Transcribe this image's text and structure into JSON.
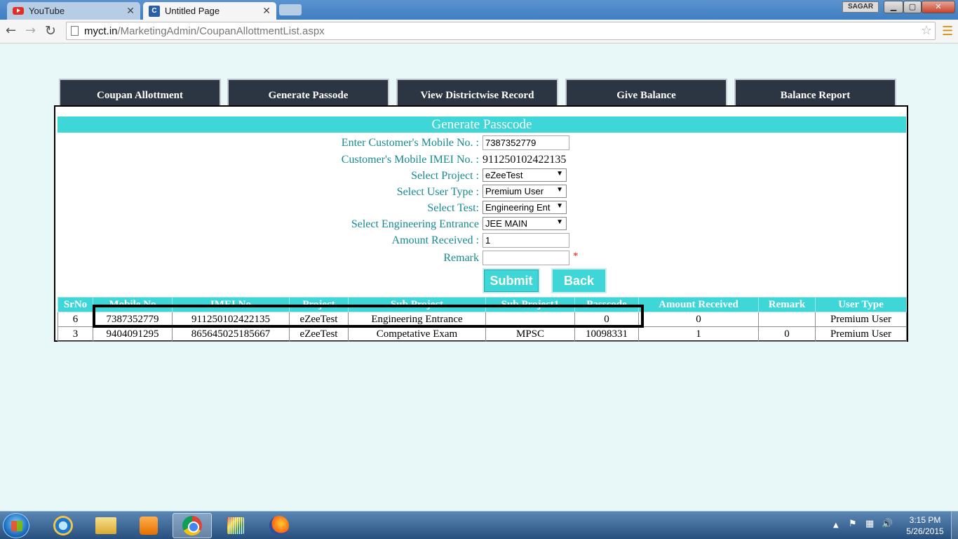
{
  "browser": {
    "tabs": [
      {
        "title": "YouTube",
        "active": false
      },
      {
        "title": "Untitled Page",
        "active": true
      }
    ],
    "user_badge": "SAGAR",
    "url_host": "myct.in",
    "url_path": "/MarketingAdmin/CoupanAllottmentList.aspx"
  },
  "nav_tabs": [
    {
      "label": "Coupan Allottment"
    },
    {
      "label": "Generate Passode"
    },
    {
      "label": "View Districtwise Record"
    },
    {
      "label": "Give Balance"
    },
    {
      "label": "Balance Report"
    }
  ],
  "form": {
    "header": "Generate Passcode",
    "mobile_label": "Enter Customer's Mobile No. :",
    "mobile_value": "7387352779",
    "imei_label": "Customer's Mobile IMEI No. :",
    "imei_value": "911250102422135",
    "project_label": "Select Project :",
    "project_value": "eZeeTest",
    "user_type_label": "Select User Type :",
    "user_type_value": "Premium User",
    "test_label": "Select Test:",
    "test_value": "Engineering Ent",
    "entrance_label": "Select Engineering Entrance",
    "entrance_value": "JEE MAIN",
    "amount_label": "Amount Received :",
    "amount_value": "1",
    "remark_label": "Remark",
    "remark_value": "",
    "required_mark": "*",
    "submit_label": "Submit",
    "back_label": "Back"
  },
  "table": {
    "columns": [
      "SrNo",
      "Mobile No",
      "IMEI No",
      "Project",
      "Sub Project",
      "Sub Project1",
      "Passcode",
      "Amount Received",
      "Remark",
      "User Type"
    ],
    "rows": [
      [
        "6",
        "7387352779",
        "911250102422135",
        "eZeeTest",
        "Engineering Entrance",
        "",
        "0",
        "0",
        "",
        "Premium User"
      ],
      [
        "3",
        "9404091295",
        "865645025185667",
        "eZeeTest",
        "Competative Exam",
        "MPSC",
        "10098331",
        "1",
        "0",
        "Premium User"
      ]
    ]
  },
  "taskbar": {
    "clock_time": "3:15 PM",
    "clock_date": "5/26/2015"
  },
  "colors": {
    "accent": "#3fd6d8",
    "nav_tab_bg": "#2c3542",
    "label_text": "#168a8f",
    "page_bg": "#e8f8f8"
  }
}
